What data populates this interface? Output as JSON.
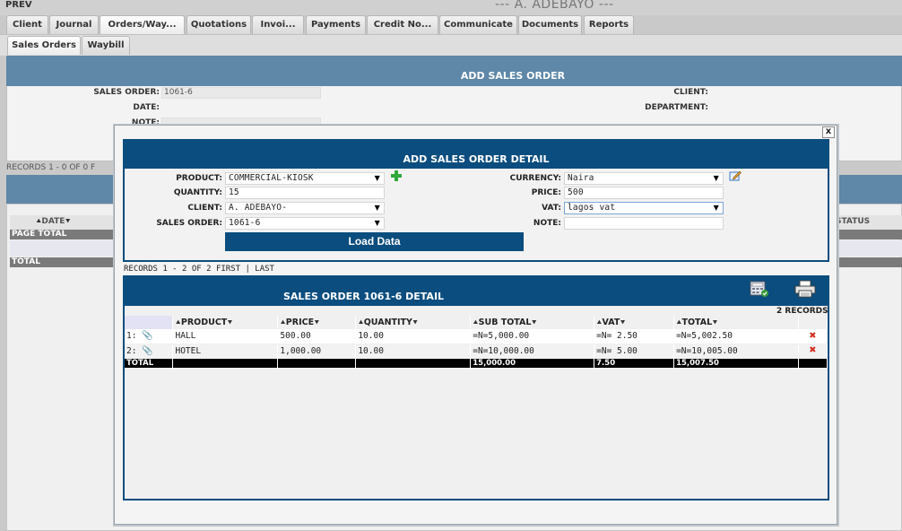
{
  "header": {
    "prev": "PREV",
    "client_title": "--- A. ADEBAYO ---"
  },
  "main_tabs": [
    {
      "label": "Client"
    },
    {
      "label": "Journal"
    },
    {
      "label": "Orders/Way..."
    },
    {
      "label": "Quotations"
    },
    {
      "label": "Invoi..."
    },
    {
      "label": "Payments"
    },
    {
      "label": "Credit No..."
    },
    {
      "label": "Communicate"
    },
    {
      "label": "Documents"
    },
    {
      "label": "Reports"
    }
  ],
  "sub_tabs": [
    {
      "label": "Sales Orders"
    },
    {
      "label": "Waybill"
    }
  ],
  "background_form": {
    "title": "ADD SALES ORDER",
    "sales_order_label": "SALES ORDER:",
    "sales_order_value": "1061-6",
    "date_label": "DATE:",
    "note_label": "NOTE:",
    "client_label": "CLIENT:",
    "department_label": "DEPARTMENT:"
  },
  "background_list": {
    "records": "RECORDS 1 - 0 OF 0 F",
    "date_col": "DATE",
    "status_col": "STATUS",
    "page_total": "PAGE TOTAL",
    "total": "TOTAL"
  },
  "modal": {
    "close": "x",
    "form": {
      "title": "ADD SALES ORDER DETAIL",
      "product_label": "PRODUCT:",
      "product_value": "COMMERCIAL-KIOSK",
      "quantity_label": "QUANTITY:",
      "quantity_value": "15",
      "client_label": "CLIENT:",
      "client_value": "A. ADEBAYO-",
      "sales_order_label": "SALES ORDER:",
      "sales_order_value": "1061-6",
      "currency_label": "CURRENCY:",
      "currency_value": "Naira",
      "price_label": "PRICE:",
      "price_value": "500",
      "vat_label": "VAT:",
      "vat_value": "lagos vat",
      "note_label": "NOTE:",
      "note_value": "",
      "load_button": "Load Data"
    },
    "records_line": "RECORDS 1 - 2 OF 2 FIRST | LAST",
    "detail": {
      "title": "SALES ORDER 1061-6 DETAIL",
      "record_count": "2 RECORDS",
      "columns": [
        "PRODUCT",
        "PRICE",
        "QUANTITY",
        "SUB TOTAL",
        "VAT",
        "TOTAL"
      ],
      "rows": [
        {
          "num": "1:",
          "product": "HALL",
          "price": "500.00",
          "quantity": "10.00",
          "sub_total": "=N=5,000.00",
          "vat": "=N= 2.50",
          "total": "=N=5,002.50"
        },
        {
          "num": "2:",
          "product": "HOTEL",
          "price": "1,000.00",
          "quantity": "10.00",
          "sub_total": "=N=10,000.00",
          "vat": "=N= 5.00",
          "total": "=N=10,005.00"
        }
      ],
      "total_row": {
        "label": "TOTAL",
        "sub_total": "15,000.00",
        "vat": "7.50",
        "total": "15,007.50"
      }
    }
  }
}
